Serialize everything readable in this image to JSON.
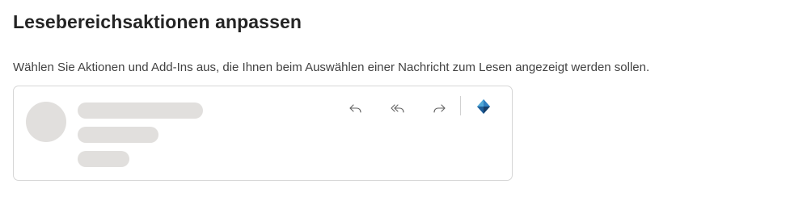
{
  "page": {
    "title": "Lesebereichsaktionen anpassen",
    "description": "Wählen Sie Aktionen und Add-Ins aus, die Ihnen beim Auswählen einer Nachricht zum Lesen angezeigt werden sollen."
  },
  "preview": {
    "actions": [
      {
        "name": "reply",
        "icon": "reply-icon"
      },
      {
        "name": "reply-all",
        "icon": "reply-all-icon"
      },
      {
        "name": "forward",
        "icon": "forward-icon"
      },
      {
        "name": "addin",
        "icon": "addin-icon"
      }
    ]
  },
  "colors": {
    "skeleton": "#e1dfdd",
    "border": "#d6d6d6",
    "icon": "#616161",
    "addin_blue_light": "#50a8d8",
    "addin_blue_dark": "#1e5e9a"
  }
}
